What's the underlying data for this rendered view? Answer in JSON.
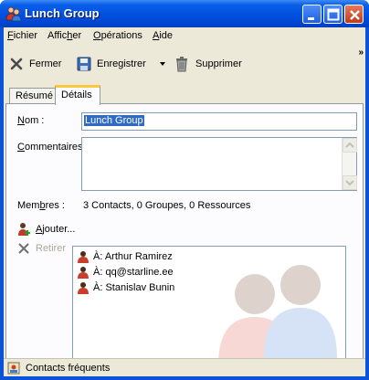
{
  "window": {
    "title": "Lunch Group"
  },
  "menu": [
    {
      "pre": "",
      "u": "F",
      "post": "ichier"
    },
    {
      "pre": "Affic",
      "u": "h",
      "post": "er"
    },
    {
      "pre": "",
      "u": "O",
      "post": "pérations"
    },
    {
      "pre": "",
      "u": "A",
      "post": "ide"
    }
  ],
  "toolbar": {
    "close_label": "Fermer",
    "save_label": "Enregistrer",
    "delete_label": "Supprimer",
    "overflow": "»"
  },
  "tabs": [
    {
      "label": "Résumé",
      "active": false
    },
    {
      "label": "Détails",
      "active": true
    }
  ],
  "form": {
    "name_label_pre": "",
    "name_label_u": "N",
    "name_label_post": "om :",
    "name_value": "Lunch Group",
    "comments_label_pre": "",
    "comments_label_u": "C",
    "comments_label_post": "ommentaires :",
    "comments_value": "",
    "members_label_pre": "Mem",
    "members_label_u": "b",
    "members_label_post": "res :",
    "members_summary": "3 Contacts, 0 Groupes, 0 Ressources"
  },
  "actions": {
    "add_pre": "",
    "add_u": "A",
    "add_post": "jouter...",
    "remove_label": "Retirer"
  },
  "members": [
    {
      "label": "À: Arthur Ramirez"
    },
    {
      "label": "À: qq@starline.ee"
    },
    {
      "label": "À: Stanislav Bunin"
    }
  ],
  "status": {
    "text": "Contacts fréquents"
  },
  "colors": {
    "titlebar": "#0052e0",
    "selection": "#316ac5",
    "tab_accent": "#ffc83c",
    "disabled_text": "#aca899"
  }
}
